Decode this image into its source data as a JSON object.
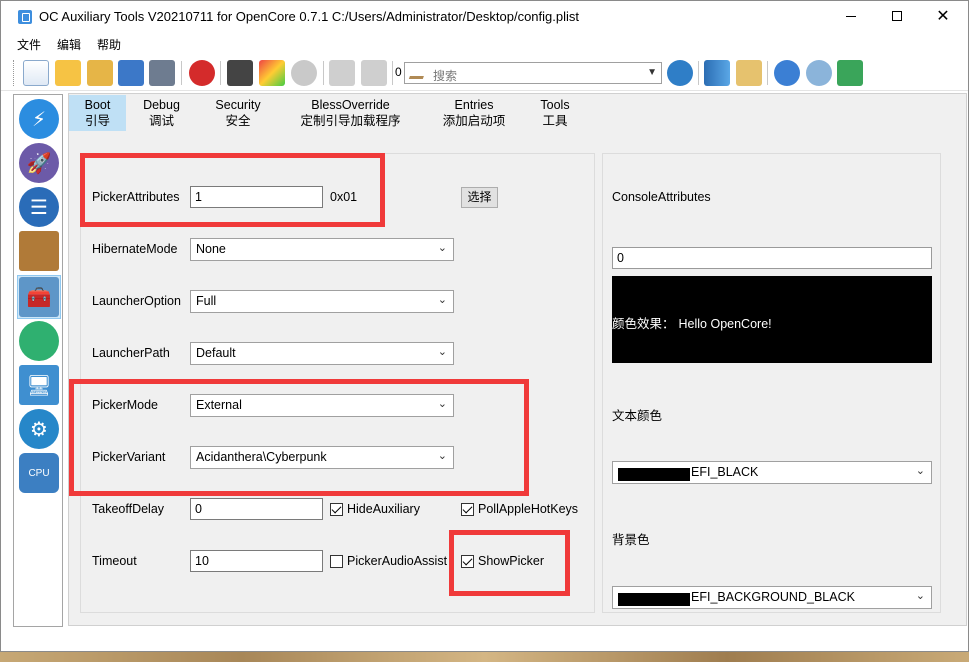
{
  "window": {
    "title": "OC Auxiliary Tools   V20210711 for OpenCore 0.7.1    C:/Users/Administrator/Desktop/config.plist"
  },
  "menu": [
    "文件",
    "编辑",
    "帮助"
  ],
  "toolbar": {
    "counter": "0",
    "search_placeholder": "搜索",
    "icons": [
      "new-file-icon",
      "open-folder-icon",
      "open-config-icon",
      "save-icon",
      "save-as-icon",
      "error-icon",
      "mount-efi-icon",
      "edit-icon",
      "refresh-icon",
      "undo-icon",
      "redo-icon",
      "find-icon",
      "database-icon",
      "folder-open-icon",
      "help-icon",
      "update-icon",
      "about-icon"
    ]
  },
  "sidebar": {
    "items": [
      "acpi-icon",
      "booter-icon",
      "device-properties-icon",
      "kernel-icon",
      "misc-icon",
      "nvram-icon",
      "platforminfo-icon",
      "uefi-icon",
      "cpu-icon"
    ],
    "selected": "misc-icon"
  },
  "tabs": [
    {
      "line1": "Boot",
      "line2": "引导"
    },
    {
      "line1": "Debug",
      "line2": "调试"
    },
    {
      "line1": "Security",
      "line2": "安全"
    },
    {
      "line1": "BlessOverride",
      "line2": "定制引导加载程序"
    },
    {
      "line1": "Entries",
      "line2": "添加启动项"
    },
    {
      "line1": "Tools",
      "line2": "工具"
    }
  ],
  "boot": {
    "picker_attributes_label": "PickerAttributes",
    "picker_attributes_value": "1",
    "picker_attributes_hex": "0x01",
    "choose_button": "选择",
    "hibernate_mode_label": "HibernateMode",
    "hibernate_mode_value": "None",
    "launcher_option_label": "LauncherOption",
    "launcher_option_value": "Full",
    "launcher_path_label": "LauncherPath",
    "launcher_path_value": "Default",
    "picker_mode_label": "PickerMode",
    "picker_mode_value": "External",
    "picker_variant_label": "PickerVariant",
    "picker_variant_value": "Acidanthera\\Cyberpunk",
    "takeoff_delay_label": "TakeoffDelay",
    "takeoff_delay_value": "0",
    "timeout_label": "Timeout",
    "timeout_value": "10",
    "hide_auxiliary_label": "HideAuxiliary",
    "hide_auxiliary_checked": true,
    "poll_apple_hotkeys_label": "PollAppleHotKeys",
    "poll_apple_hotkeys_checked": true,
    "picker_audio_assist_label": "PickerAudioAssist",
    "picker_audio_assist_checked": false,
    "show_picker_label": "ShowPicker",
    "show_picker_checked": true
  },
  "console": {
    "attributes_label": "ConsoleAttributes",
    "attributes_value": "0",
    "preview_label": "颜色效果：",
    "preview_text": "Hello OpenCore!",
    "text_color_label": "文本颜色",
    "text_color_value": "EFI_BLACK",
    "bg_color_label": "背景色",
    "bg_color_value": "EFI_BACKGROUND_BLACK"
  },
  "colors": {
    "highlight_red": "#f03a3a",
    "tab_active": "#bfe0f5",
    "preview_bg": "#000000"
  }
}
